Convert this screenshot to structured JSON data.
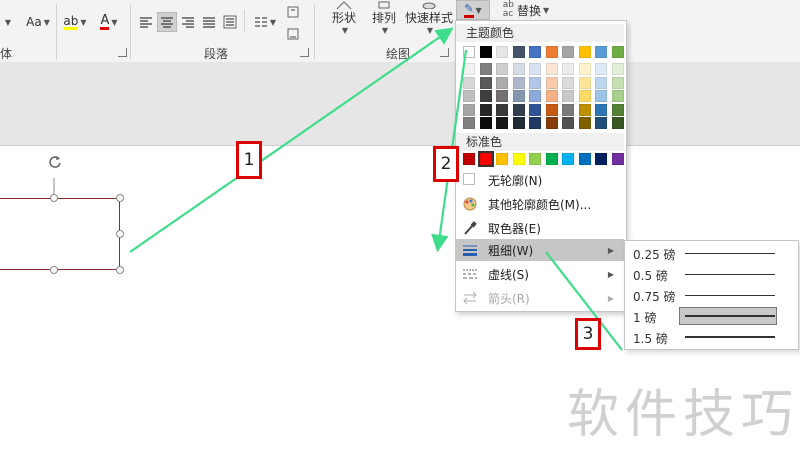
{
  "ribbon": {
    "font_group_label_fragment": "体",
    "font_size_button": "Aa",
    "paragraph_group_label": "段落",
    "drawing_group_label": "绘图",
    "shape_button": "形状",
    "arrange_button": "排列",
    "quick_style_button": "快速样式",
    "replace_button": "替换"
  },
  "callouts": {
    "one": "1",
    "two": "2",
    "three": "3"
  },
  "outline_menu": {
    "theme_colors_header": "主题颜色",
    "standard_colors_header": "标准色",
    "items": [
      {
        "label": "无轮廓(N)",
        "icon": "blank-swatch-icon",
        "disabled": false
      },
      {
        "label": "其他轮廓颜色(M)...",
        "icon": "color-palette-icon",
        "disabled": false
      },
      {
        "label": "取色器(E)",
        "icon": "eyedropper-icon",
        "disabled": false
      },
      {
        "label": "粗细(W)",
        "icon": "line-weight-icon",
        "disabled": false,
        "submenu": true,
        "highlighted": true
      },
      {
        "label": "虚线(S)",
        "icon": "dash-line-icon",
        "disabled": false,
        "submenu": true
      },
      {
        "label": "箭头(R)",
        "icon": "arrow-style-icon",
        "disabled": true,
        "submenu": true
      }
    ],
    "theme_top_row": [
      "#ffffff",
      "#000000",
      "#e7e6e6",
      "#44546a",
      "#4472c4",
      "#ed7d31",
      "#a5a5a5",
      "#ffc000",
      "#5b9bd5",
      "#70ad47"
    ],
    "theme_shades": [
      [
        "#f2f2f2",
        "#7f7f7f",
        "#d0cece",
        "#d6dce4",
        "#d9e2f3",
        "#fbe5d5",
        "#ededed",
        "#fff2cc",
        "#deebf6",
        "#e2efd9"
      ],
      [
        "#d8d8d8",
        "#595959",
        "#aeabab",
        "#adb9ca",
        "#b4c6e7",
        "#f7cbac",
        "#dbdbdb",
        "#fee599",
        "#bdd7ee",
        "#c5e0b3"
      ],
      [
        "#bfbfbf",
        "#3f3f3f",
        "#757070",
        "#8496b0",
        "#8eaadb",
        "#f4b183",
        "#c9c9c9",
        "#ffd965",
        "#9cc3e5",
        "#a8d08d"
      ],
      [
        "#a5a5a5",
        "#262626",
        "#3a3838",
        "#323f4f",
        "#2f5496",
        "#c55a11",
        "#7b7b7b",
        "#bf9000",
        "#2e75b5",
        "#538135"
      ],
      [
        "#7f7f7f",
        "#0c0c0c",
        "#171616",
        "#222a35",
        "#1f3864",
        "#833c0b",
        "#525252",
        "#7f6000",
        "#1f4e79",
        "#375623"
      ]
    ],
    "standard_colors": [
      "#c00000",
      "#ff0000",
      "#ffc000",
      "#ffff00",
      "#92d050",
      "#00b050",
      "#00b0f0",
      "#0070c0",
      "#002060",
      "#7030a0"
    ]
  },
  "weight_submenu": {
    "items": [
      {
        "label": "0.25 磅",
        "weight": 0.25
      },
      {
        "label": "0.5 磅",
        "weight": 0.5
      },
      {
        "label": "0.75 磅",
        "weight": 0.75
      },
      {
        "label": "1 磅",
        "weight": 1,
        "selected": true
      },
      {
        "label": "1.5 磅",
        "weight": 1.5
      }
    ]
  },
  "watermark": "软件技巧",
  "colors": {
    "annotation_arrow": "#3fdc8c",
    "callout_border": "#dd0000",
    "shape_outline": "#8b2b2b",
    "menu_highlight": "#c6c6c6"
  }
}
